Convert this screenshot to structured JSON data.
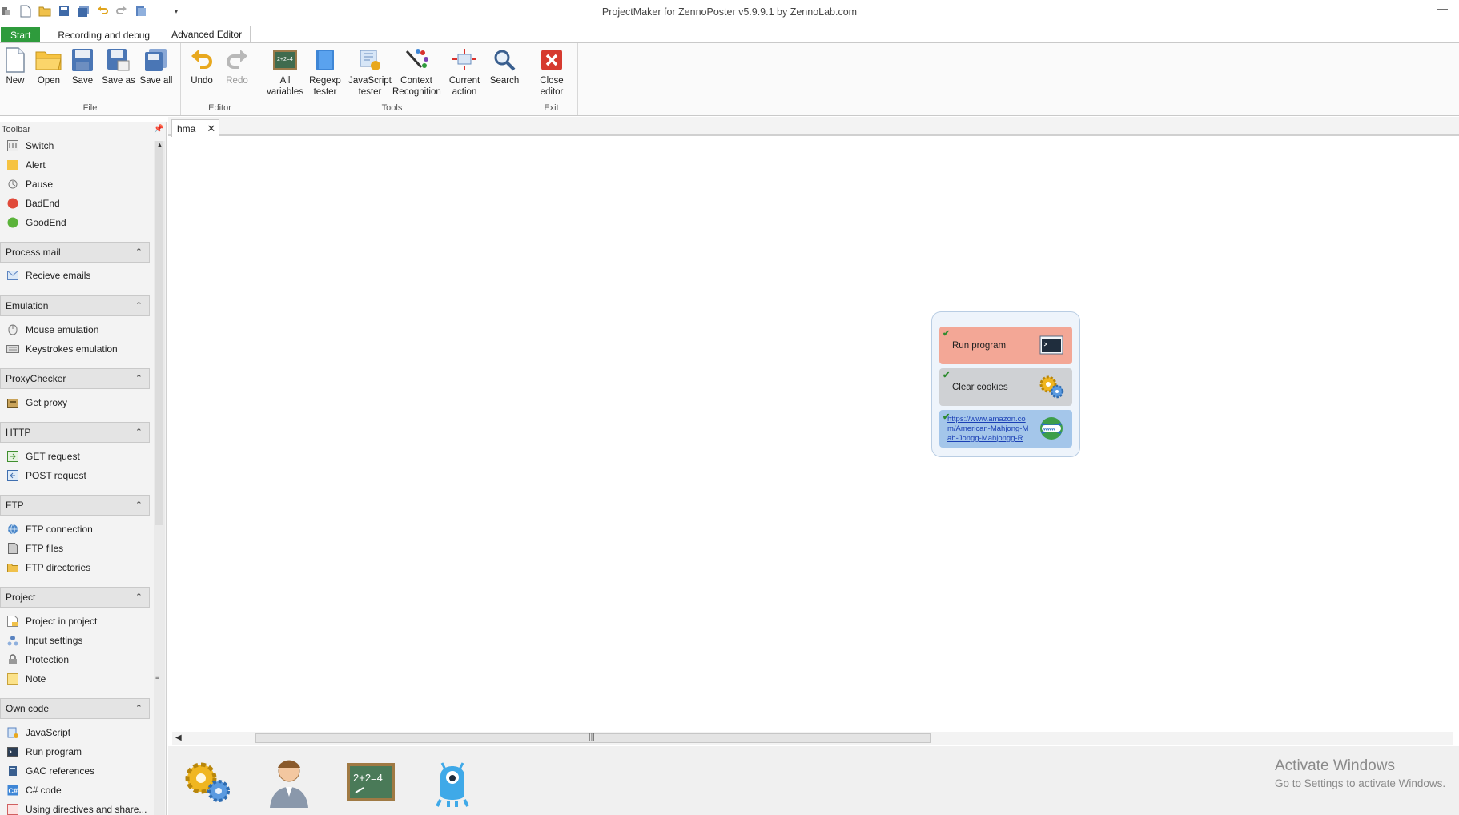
{
  "window": {
    "title": "ProjectMaker for ZennoPoster v5.9.9.1 by ZennoLab.com",
    "minimize_glyph": "—"
  },
  "quick_access": [
    "new-icon",
    "open-icon",
    "save-icon",
    "save-all-icon",
    "undo-icon",
    "redo-icon",
    "copy-icon",
    "customize-icon"
  ],
  "ribbon_tabs": [
    "Start",
    "Recording and debug",
    "Advanced Editor"
  ],
  "ribbon": {
    "file": {
      "label": "File",
      "new": "New",
      "open": "Open",
      "save": "Save",
      "save_as": "Save as",
      "save_all": "Save all"
    },
    "editor": {
      "label": "Editor",
      "undo": "Undo",
      "redo": "Redo"
    },
    "tools": {
      "label": "Tools",
      "all_variables_1": "All",
      "all_variables_2": "variables",
      "regexp_1": "Regexp",
      "regexp_2": "tester",
      "js_1": "JavaScript",
      "js_2": "tester",
      "context_1": "Context",
      "context_2": "Recognition",
      "current_1": "Current",
      "current_2": "action",
      "search": "Search"
    },
    "exit": {
      "label": "Exit",
      "close_1": "Close",
      "close_2": "editor"
    }
  },
  "toolbar_panel": {
    "title": "Toolbar",
    "top_items": [
      "Switch",
      "Alert",
      "Pause",
      "BadEnd",
      "GoodEnd"
    ],
    "sections": {
      "process_mail": {
        "title": "Process mail",
        "items": [
          "Recieve emails"
        ]
      },
      "emulation": {
        "title": "Emulation",
        "items": [
          "Mouse emulation",
          "Keystrokes emulation"
        ]
      },
      "proxychecker": {
        "title": "ProxyChecker",
        "items": [
          "Get proxy"
        ]
      },
      "http": {
        "title": "HTTP",
        "items": [
          "GET request",
          "POST request"
        ]
      },
      "ftp": {
        "title": "FTP",
        "items": [
          "FTP connection",
          "FTP files",
          "FTP directories"
        ]
      },
      "project": {
        "title": "Project",
        "items": [
          "Project in project",
          "Input settings",
          "Protection",
          "Note"
        ]
      },
      "own_code": {
        "title": "Own code",
        "items": [
          "JavaScript",
          "Run program",
          "GAC references",
          "C# code",
          "Using directives and share..."
        ]
      }
    }
  },
  "document": {
    "tab_label": "hma",
    "actions": [
      {
        "label": "Run program",
        "color": "#f3a796"
      },
      {
        "label": "Clear cookies",
        "color": "#cfd1d4"
      },
      {
        "label": "https://www.amazon.com/American-Mahjong-Mah-Jongg-Mahjongg-R",
        "color": "#a4c6ea"
      }
    ]
  },
  "watermark": {
    "line1": "Activate Windows",
    "line2": "Go to Settings to activate Windows."
  }
}
